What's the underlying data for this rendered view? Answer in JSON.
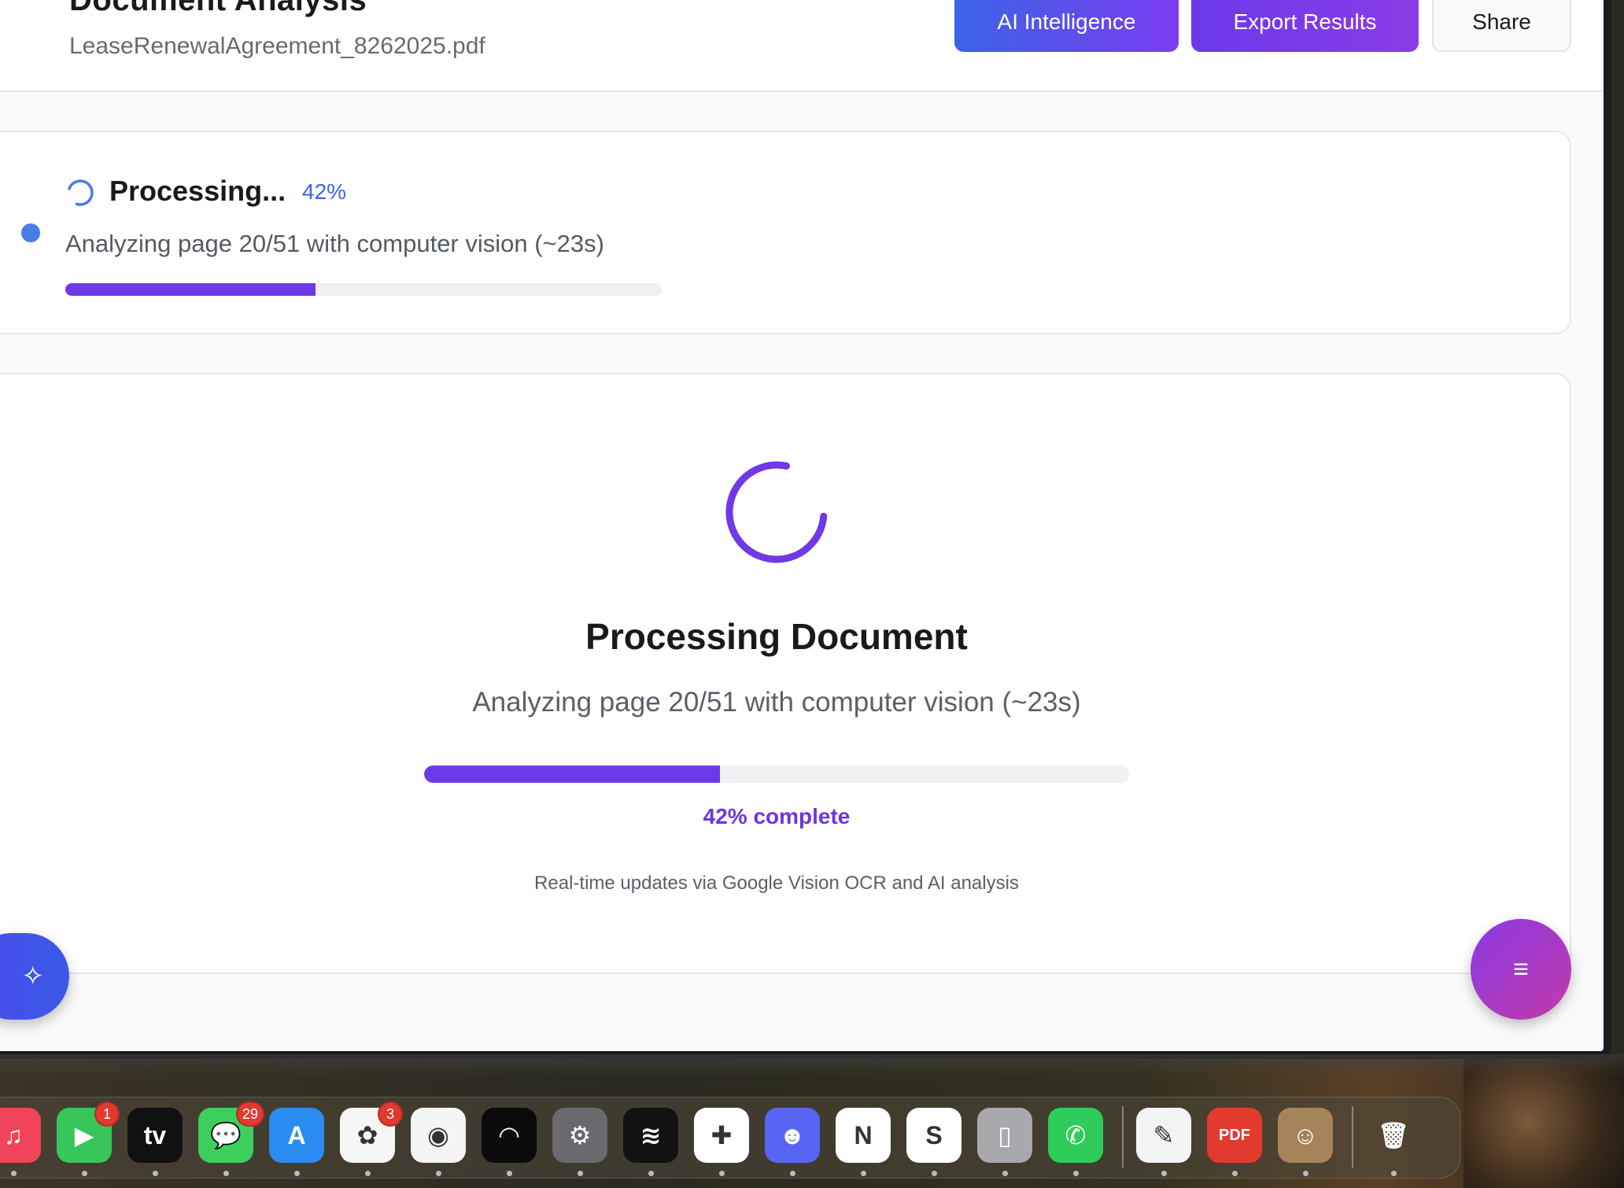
{
  "header": {
    "title": "Document Analysis",
    "file_name": "LeaseRenewalAgreement_8262025.pdf",
    "ai_button": "AI Intelligence",
    "export_button": "Export Results",
    "share_button": "Share"
  },
  "status": {
    "title": "Processing...",
    "percent_label": "42%",
    "message": "Analyzing page 20/51 with computer vision (~23s)",
    "progress": 0.42
  },
  "main": {
    "title": "Processing Document",
    "message": "Analyzing page 20/51 with computer vision (~23s)",
    "percent_label": "42% complete",
    "note": "Real-time updates via Google Vision OCR and AI analysis",
    "progress": 0.42
  },
  "fab": {
    "left_icon": "sparkles-icon",
    "right_icon": "menu-icon",
    "left_glyph": "✧",
    "right_glyph": "≡"
  },
  "dock": {
    "items": [
      {
        "name": "music",
        "glyph": "♫",
        "color": "#f0445a",
        "badge": null
      },
      {
        "name": "facetime",
        "glyph": "▶",
        "color": "#38c55a",
        "badge": "1"
      },
      {
        "name": "apple-tv",
        "glyph": "tv",
        "color": "#111111",
        "badge": null
      },
      {
        "name": "messages",
        "glyph": "💬",
        "color": "#3ccf5c",
        "badge": "29"
      },
      {
        "name": "app-store",
        "glyph": "A",
        "color": "#2a8cf0",
        "badge": null
      },
      {
        "name": "photos",
        "glyph": "✿",
        "color": "#f6f6f6",
        "badge": "3"
      },
      {
        "name": "chrome",
        "glyph": "◉",
        "color": "#f4f4f4",
        "badge": null
      },
      {
        "name": "wave-app",
        "glyph": "◠",
        "color": "#0b0b0b",
        "badge": null
      },
      {
        "name": "system-settings",
        "glyph": "⚙",
        "color": "#6a6a6e",
        "badge": null
      },
      {
        "name": "spotify",
        "glyph": "≋",
        "color": "#121212",
        "badge": null
      },
      {
        "name": "slack",
        "glyph": "✚",
        "color": "#ffffff",
        "badge": null
      },
      {
        "name": "discord",
        "glyph": "☻",
        "color": "#5865f2",
        "badge": null
      },
      {
        "name": "news",
        "glyph": "N",
        "color": "#ffffff",
        "badge": null
      },
      {
        "name": "skype",
        "glyph": "S",
        "color": "#ffffff",
        "badge": null
      },
      {
        "name": "iphone-mirroring",
        "glyph": "▯",
        "color": "#a8a8ad",
        "badge": null
      },
      {
        "name": "whatsapp",
        "glyph": "✆",
        "color": "#2ecc5a",
        "badge": null
      },
      {
        "name": "textedit",
        "glyph": "✎",
        "color": "#f4f4f4",
        "badge": null
      },
      {
        "name": "pdf-editor",
        "glyph": "PDF",
        "color": "#e23a2f",
        "badge": null
      },
      {
        "name": "contacts",
        "glyph": "☺",
        "color": "#a6845a",
        "badge": null
      },
      {
        "name": "trash",
        "glyph": "🗑",
        "color": "transparent",
        "badge": null
      }
    ]
  }
}
